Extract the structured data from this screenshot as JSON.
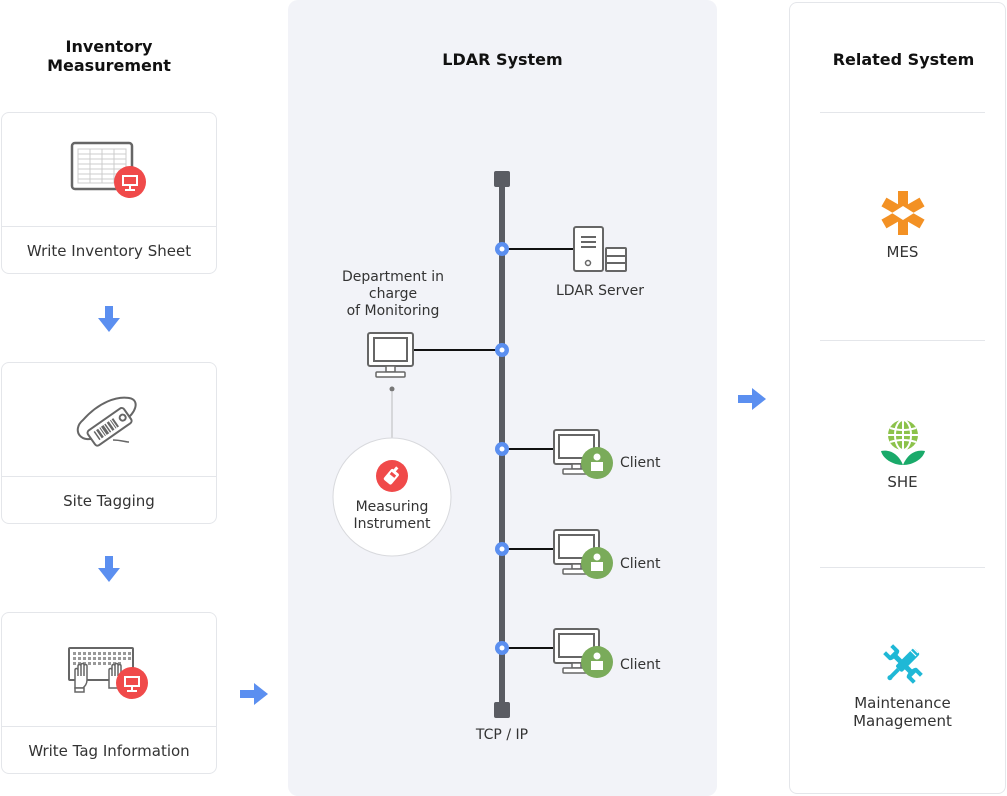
{
  "inventory": {
    "title_line1": "Inventory",
    "title_line2": "Measurement",
    "steps": [
      {
        "label": "Write Inventory Sheet",
        "icon": "spreadsheet-icon"
      },
      {
        "label": "Site Tagging",
        "icon": "barcode-tag-icon"
      },
      {
        "label": "Write Tag Information",
        "icon": "keyboard-typing-icon"
      }
    ]
  },
  "ldar": {
    "title": "LDAR System",
    "server_label": "LDAR Server",
    "department_label_line1": "Department in",
    "department_label_line2": "charge",
    "department_label_line3": "of Monitoring",
    "instrument_label_line1": "Measuring",
    "instrument_label_line2": "Instrument",
    "clients": [
      "Client",
      "Client",
      "Client"
    ],
    "network_label": "TCP / IP"
  },
  "related": {
    "title": "Related System",
    "items": [
      {
        "label_line1": "MES",
        "label_line2": "",
        "icon": "mes-icon"
      },
      {
        "label_line1": "SHE",
        "label_line2": "",
        "icon": "she-globe-plant-icon"
      },
      {
        "label_line1": "Maintenance",
        "label_line2": "Management",
        "icon": "tools-icon"
      }
    ]
  },
  "colors": {
    "accent_blue": "#5b8ff0",
    "badge_red": "#f04a4a",
    "client_green": "#7aab5a",
    "mes_orange": "#f39124",
    "she_green": "#8cc24a",
    "she_leaf": "#1aaa6a",
    "tools_cyan": "#1fb8d6",
    "bus_gray": "#5a5c63",
    "panel_bg": "#f2f3f8"
  }
}
